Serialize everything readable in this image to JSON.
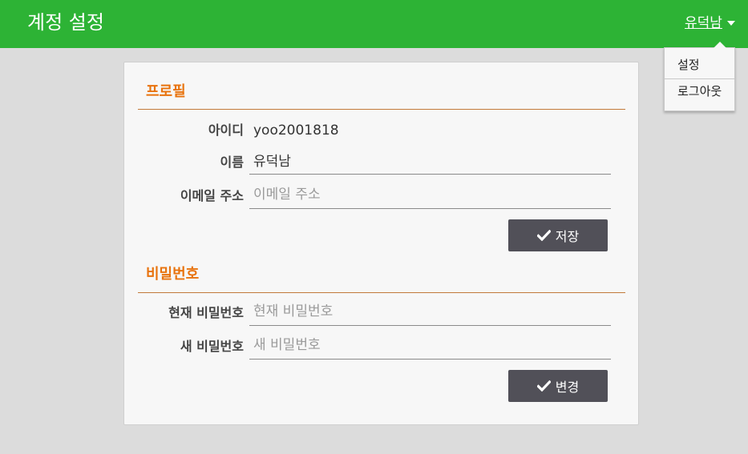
{
  "header": {
    "title": "계정 설정",
    "user_name": "유덕남",
    "bg_color": "#2db335"
  },
  "dropdown": {
    "items": [
      "설정",
      "로그아웃"
    ]
  },
  "profile": {
    "section_title": "프로필",
    "id_label": "아이디",
    "id_value": "yoo2001818",
    "name_label": "이름",
    "name_value": "유덕남",
    "email_label": "이메일 주소",
    "email_placeholder": "이메일 주소",
    "save_label": "저장",
    "save_icon": "check-icon"
  },
  "password": {
    "section_title": "비밀번호",
    "current_label": "현재 비밀번호",
    "current_placeholder": "현재 비밀번호",
    "new_label": "새 비밀번호",
    "new_placeholder": "새 비밀번호",
    "change_label": "변경",
    "change_icon": "check-icon"
  },
  "colors": {
    "accent": "#e8730e",
    "button": "#515058"
  }
}
